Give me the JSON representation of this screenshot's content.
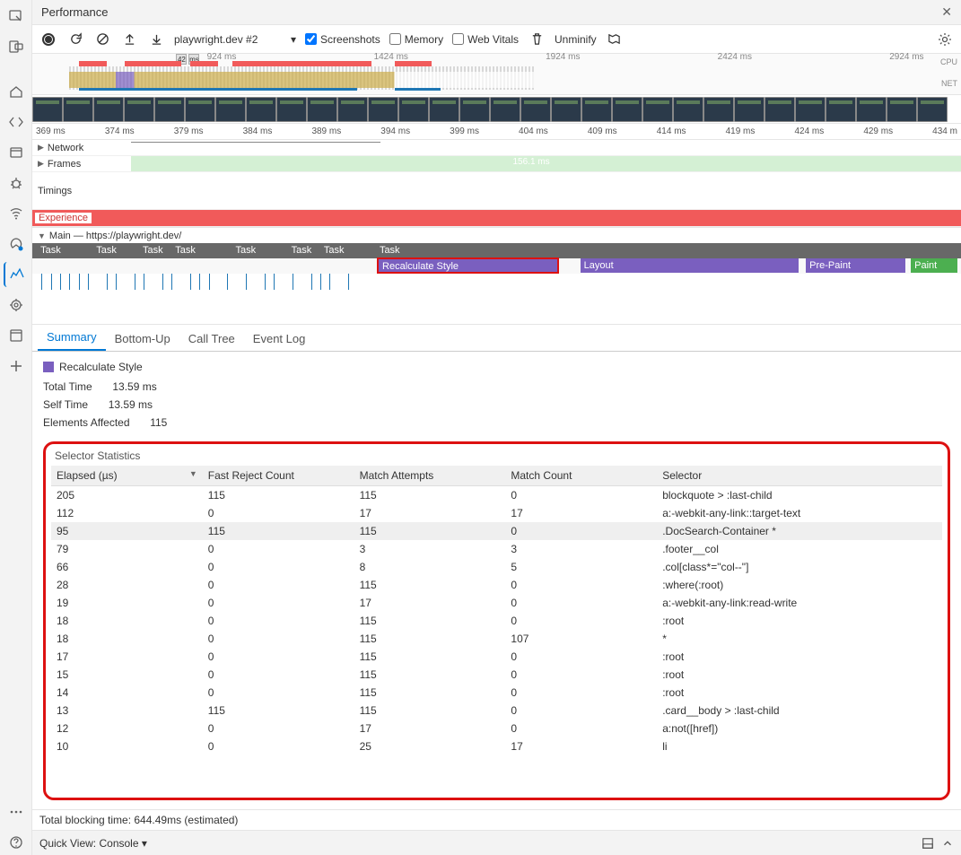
{
  "panel": {
    "title": "Performance"
  },
  "toolbar": {
    "target": "playwright.dev #2",
    "chk_screenshots": "Screenshots",
    "chk_memory": "Memory",
    "chk_webvitals": "Web Vitals",
    "unminify": "Unminify"
  },
  "overview": {
    "marks": [
      "42",
      "ms",
      "924 ms",
      "1424 ms",
      "1924 ms",
      "2424 ms",
      "2924 ms"
    ],
    "cpu_label": "CPU",
    "net_label": "NET"
  },
  "ruler_ticks": [
    "369 ms",
    "374 ms",
    "379 ms",
    "384 ms",
    "389 ms",
    "394 ms",
    "399 ms",
    "404 ms",
    "409 ms",
    "414 ms",
    "419 ms",
    "424 ms",
    "429 ms",
    "434 m"
  ],
  "tracks": {
    "network": "Network",
    "frames": "Frames",
    "frames_center": "156.1 ms",
    "timings": "Timings",
    "experience": "Experience",
    "main": "Main — https://playwright.dev/"
  },
  "flame": {
    "task": "Task",
    "recalc": "Recalculate Style",
    "layout": "Layout",
    "prepaint": "Pre-Paint",
    "paint": "Paint"
  },
  "tabs": {
    "summary": "Summary",
    "bottomup": "Bottom-Up",
    "calltree": "Call Tree",
    "eventlog": "Event Log"
  },
  "summary": {
    "event": "Recalculate Style",
    "total_lbl": "Total Time",
    "total_val": "13.59 ms",
    "self_lbl": "Self Time",
    "self_val": "13.59 ms",
    "elem_lbl": "Elements Affected",
    "elem_val": "115"
  },
  "stats": {
    "title": "Selector Statistics",
    "headers": [
      "Elapsed (µs)",
      "Fast Reject Count",
      "Match Attempts",
      "Match Count",
      "Selector"
    ],
    "rows": [
      [
        "205",
        "115",
        "115",
        "0",
        "blockquote > :last-child"
      ],
      [
        "112",
        "0",
        "17",
        "17",
        "a:-webkit-any-link::target-text"
      ],
      [
        "95",
        "115",
        "115",
        "0",
        ".DocSearch-Container *"
      ],
      [
        "79",
        "0",
        "3",
        "3",
        ".footer__col"
      ],
      [
        "66",
        "0",
        "8",
        "5",
        ".col[class*=\"col--\"]"
      ],
      [
        "28",
        "0",
        "115",
        "0",
        ":where(:root)"
      ],
      [
        "19",
        "0",
        "17",
        "0",
        "a:-webkit-any-link:read-write"
      ],
      [
        "18",
        "0",
        "115",
        "0",
        ":root"
      ],
      [
        "18",
        "0",
        "115",
        "107",
        "*"
      ],
      [
        "17",
        "0",
        "115",
        "0",
        ":root"
      ],
      [
        "15",
        "0",
        "115",
        "0",
        ":root"
      ],
      [
        "14",
        "0",
        "115",
        "0",
        ":root"
      ],
      [
        "13",
        "115",
        "115",
        "0",
        ".card__body > :last-child"
      ],
      [
        "12",
        "0",
        "17",
        "0",
        "a:not([href])"
      ],
      [
        "10",
        "0",
        "25",
        "17",
        "li"
      ]
    ]
  },
  "footer": {
    "blocking": "Total blocking time: 644.49ms (estimated)"
  },
  "quickview": {
    "label": "Quick View:",
    "value": "Console"
  }
}
